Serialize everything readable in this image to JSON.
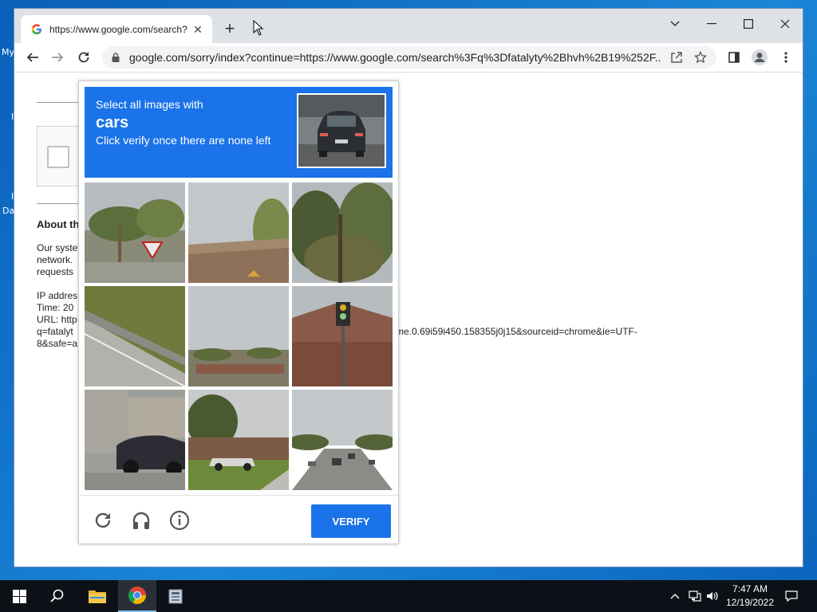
{
  "desktop": {
    "labels": [
      "My",
      "I",
      "I",
      "Da"
    ]
  },
  "browser": {
    "tab_title": "https://www.google.com/search?",
    "url": "google.com/sorry/index?continue=https://www.google.com/search%3Fq%3Dfatalyty%2Bhvh%2B19%252F..."
  },
  "page": {
    "about_heading": "About th",
    "para1": [
      "Our syste",
      "network.",
      "requests"
    ],
    "para2": [
      "IP addres",
      "Time: 20",
      "URL: http",
      "q=fatalyt",
      "8&safe=a"
    ],
    "url_tail_line1": "me.0.69i59i450.158355j0j15&sourceid=chrome&ie=UTF-",
    "url_tail_line2": ""
  },
  "captcha": {
    "line1": "Select all images with",
    "target": "cars",
    "line3": "Click verify once there are none left",
    "verify_label": "VERIFY",
    "tiles": [
      {
        "name": "palm-trees-yield-sign"
      },
      {
        "name": "palm-trees-rooftop"
      },
      {
        "name": "trees-sky"
      },
      {
        "name": "road-guardrail"
      },
      {
        "name": "field-buildings"
      },
      {
        "name": "traffic-light-building"
      },
      {
        "name": "parked-car-building"
      },
      {
        "name": "house-pickup-truck"
      },
      {
        "name": "road-with-cars"
      }
    ],
    "colors": {
      "header": "#1a73e8",
      "button": "#1a73e8"
    }
  },
  "taskbar": {
    "time": "7:47 AM",
    "date": "12/19/2022"
  }
}
